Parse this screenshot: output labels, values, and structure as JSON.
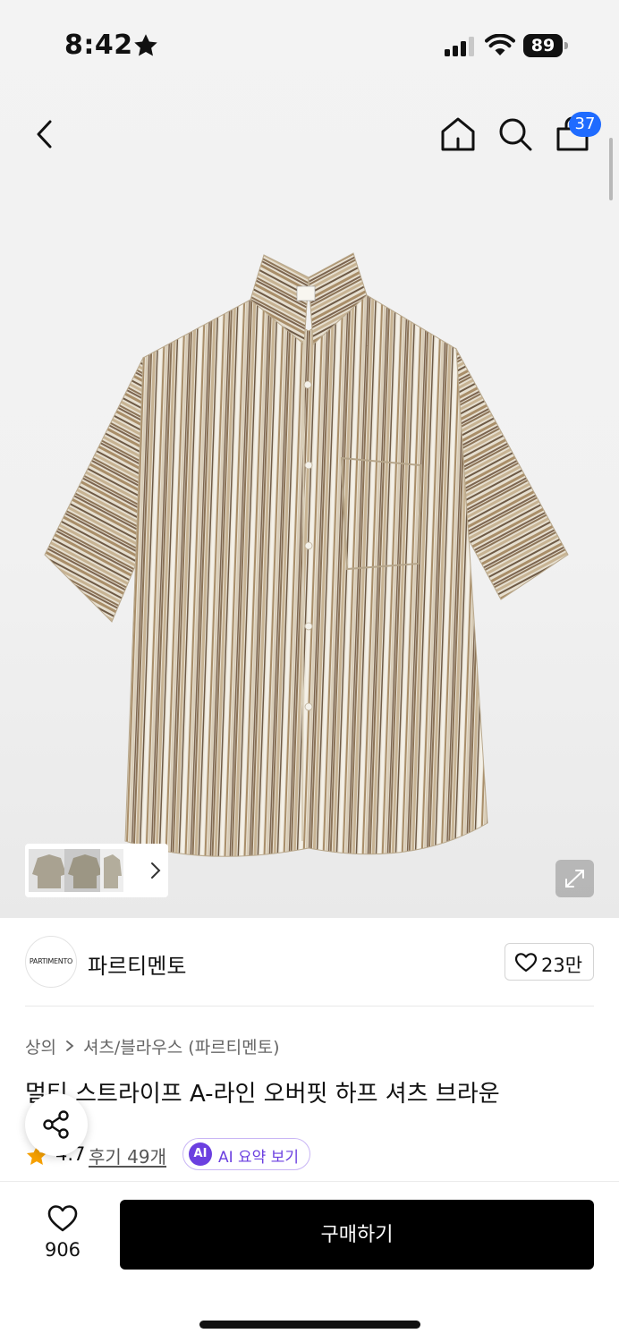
{
  "status_bar": {
    "time": "8:42",
    "battery": "89"
  },
  "header": {
    "cart_count": "37",
    "icons": [
      "back-icon",
      "home-icon",
      "search-icon",
      "shopping-bag-icon"
    ]
  },
  "gallery": {
    "thumbnail_count": 3
  },
  "brand": {
    "logo_text": "PARTIMENTO",
    "name": "파르티멘토",
    "likes": "23만"
  },
  "breadcrumb": {
    "level1": "상의",
    "level2": "셔츠/블라우스 (파르티멘토)"
  },
  "product": {
    "title": "멀티 스트라이프 A-라인 오버핏 하프 셔츠 브라운",
    "rating": "4.7",
    "reviews": "후기 49개",
    "ai_badge": "AI",
    "ai_summary": "AI 요약 보기"
  },
  "bottom_bar": {
    "wish_count": "906",
    "buy_label": "구매하기"
  },
  "colors": {
    "accent_blue": "#1f6bff",
    "ai_purple": "#6b3fe0",
    "rating_star": "#f6a000"
  }
}
